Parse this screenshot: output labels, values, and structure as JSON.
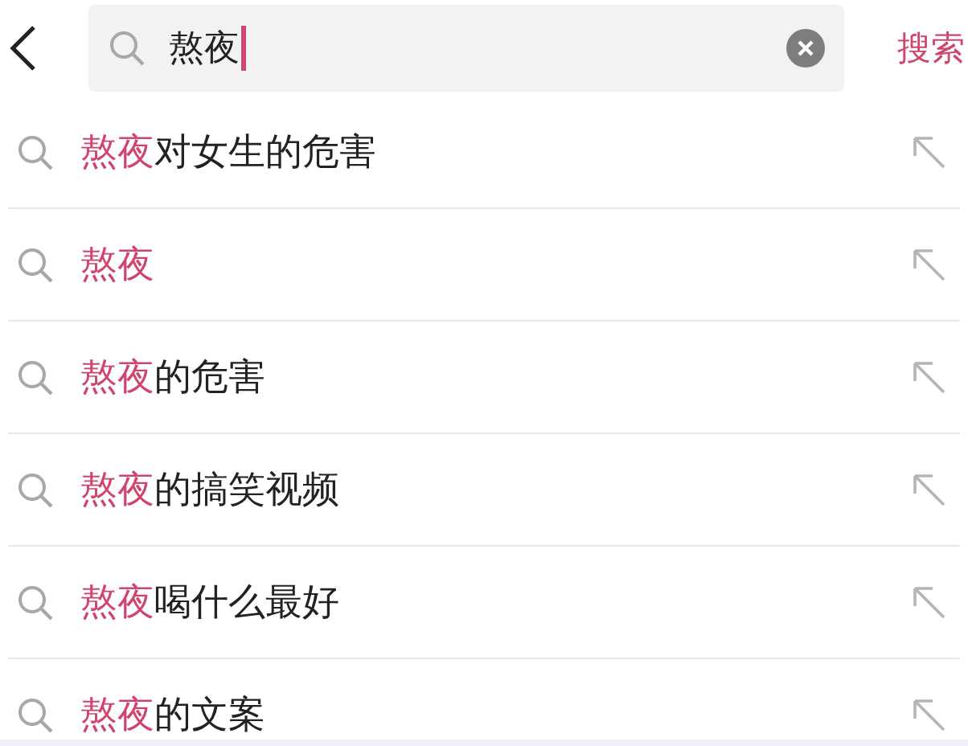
{
  "search": {
    "value": "熬夜",
    "button": "搜索"
  },
  "suggestions": [
    {
      "match": "熬夜",
      "rest": "对女生的危害"
    },
    {
      "match": "熬夜"
    },
    {
      "match": "熬夜",
      "rest": "的危害"
    },
    {
      "match": "熬夜",
      "rest": "的搞笑视频"
    },
    {
      "match": "熬夜",
      "rest": "喝什么最好"
    },
    {
      "match": "熬夜",
      "rest": "的文案"
    }
  ]
}
